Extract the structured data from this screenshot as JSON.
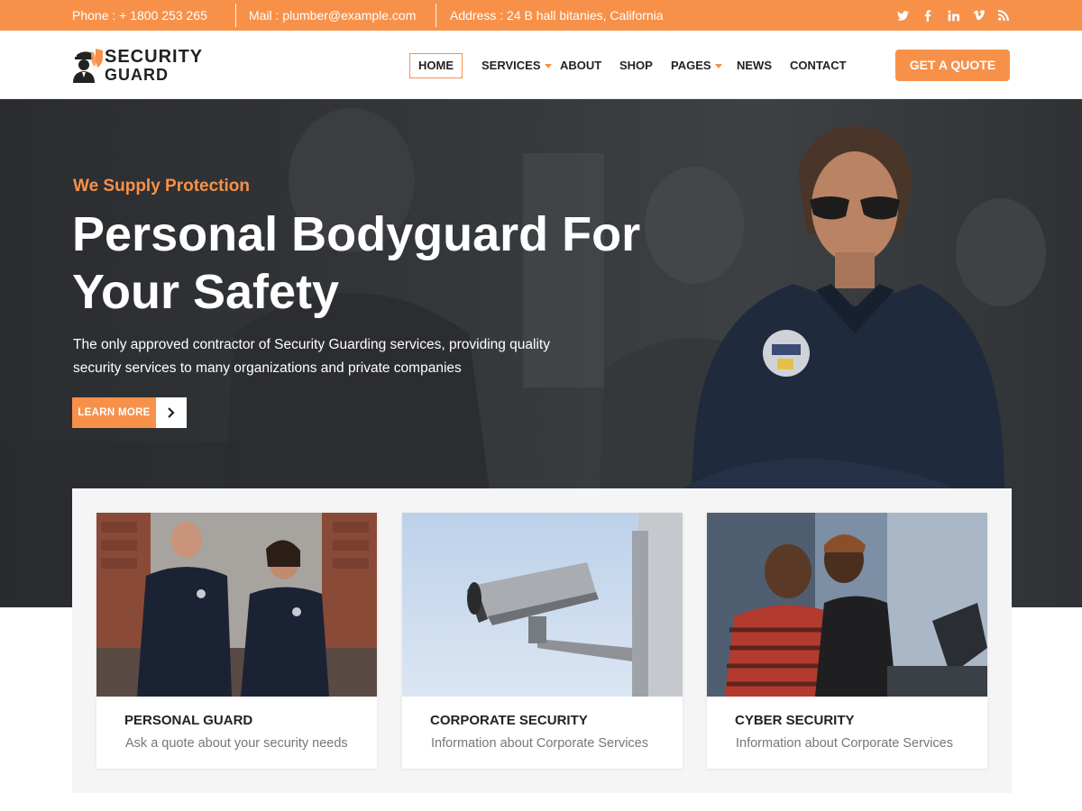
{
  "topbar": {
    "phone": "Phone : + 1800 253 265",
    "mail": "Mail : plumber@example.com",
    "address": "Address : 24 B hall bitanies, California",
    "social_icons": [
      "twitter-icon",
      "facebook-icon",
      "linkedin-icon",
      "vimeo-icon",
      "rss-icon"
    ]
  },
  "header": {
    "logo_line1": "SECURITY",
    "logo_line2": "GUARD",
    "nav": [
      {
        "label": "HOME"
      },
      {
        "label": "SERVICES"
      },
      {
        "label": "ABOUT"
      },
      {
        "label": "SHOP"
      },
      {
        "label": "PAGES"
      },
      {
        "label": "NEWS"
      },
      {
        "label": "CONTACT"
      }
    ],
    "cta": "GET A QUOTE"
  },
  "hero": {
    "subtitle": "We Supply Protection",
    "title": "Personal Bodyguard For Your Safety",
    "description": "The only approved contractor of Security Guarding services, providing quality security services to many organizations and private companies",
    "button": "LEARN MORE"
  },
  "services": [
    {
      "title": "PERSONAL GUARD",
      "description": "Ask a quote about your security needs"
    },
    {
      "title": "CORPORATE SECURITY",
      "description": "Information about Corporate Services"
    },
    {
      "title": "CYBER SECURITY",
      "description": "Information about Corporate Services"
    }
  ],
  "colors": {
    "accent": "#f7914a",
    "dark": "#222222",
    "muted": "#777777"
  }
}
